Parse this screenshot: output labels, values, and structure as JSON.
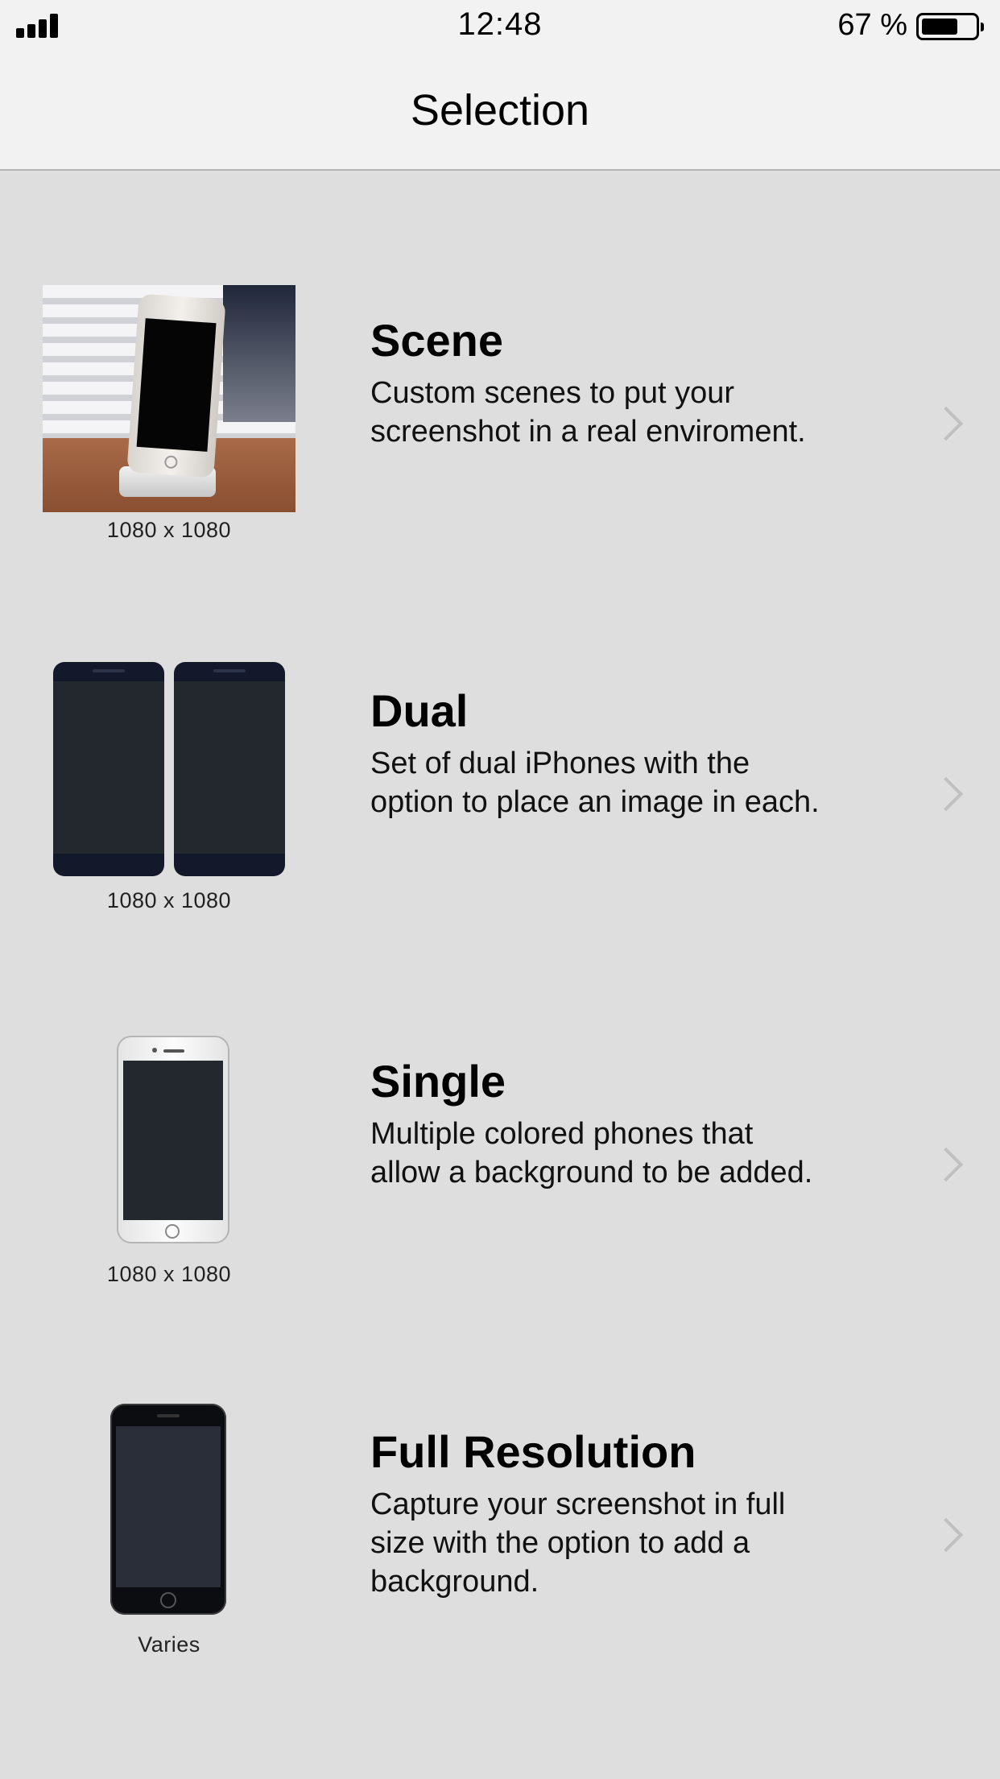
{
  "status_bar": {
    "time": "12:48",
    "battery_percent": "67 %",
    "battery_level": 0.67,
    "signal_icon": "cellular-signal-icon",
    "battery_icon": "battery-icon"
  },
  "nav": {
    "title": "Selection"
  },
  "options": [
    {
      "title": "Scene",
      "description": "Custom scenes to put your screenshot in a real enviroment.",
      "caption": "1080 x 1080"
    },
    {
      "title": "Dual",
      "description": "Set of dual iPhones with the option to place an image in each.",
      "caption": "1080 x 1080"
    },
    {
      "title": "Single",
      "description": "Multiple colored phones that allow a background to be added.",
      "caption": "1080 x 1080"
    },
    {
      "title": "Full Resolution",
      "description": "Capture your screenshot in full size with the option to add a background.",
      "caption": "Varies"
    }
  ],
  "colors": {
    "background": "#dedede",
    "bar_background": "#f2f2f2",
    "chevron": "#c0c0c0"
  }
}
